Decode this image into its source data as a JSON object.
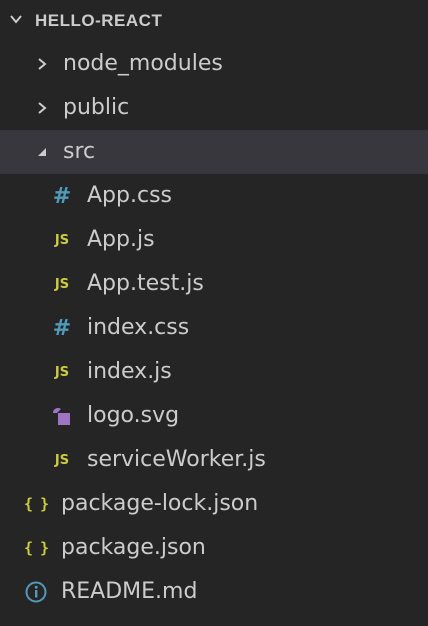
{
  "explorer": {
    "section_title": "HELLO-REACT",
    "items": [
      {
        "label": "node_modules",
        "kind": "folder",
        "state": "collapsed",
        "depth": 1
      },
      {
        "label": "public",
        "kind": "folder",
        "state": "collapsed",
        "depth": 1
      },
      {
        "label": "src",
        "kind": "folder",
        "state": "expanded",
        "depth": 1,
        "selected": true
      },
      {
        "label": "App.css",
        "kind": "css",
        "depth": 2
      },
      {
        "label": "App.js",
        "kind": "js",
        "depth": 2
      },
      {
        "label": "App.test.js",
        "kind": "js",
        "depth": 2
      },
      {
        "label": "index.css",
        "kind": "css",
        "depth": 2
      },
      {
        "label": "index.js",
        "kind": "js",
        "depth": 2
      },
      {
        "label": "logo.svg",
        "kind": "svg",
        "depth": 2
      },
      {
        "label": "serviceWorker.js",
        "kind": "js",
        "depth": 2
      },
      {
        "label": "package-lock.json",
        "kind": "json",
        "depth": 1
      },
      {
        "label": "package.json",
        "kind": "json",
        "depth": 1
      },
      {
        "label": "README.md",
        "kind": "info",
        "depth": 1
      }
    ],
    "icon_glyphs": {
      "js": "JS",
      "css": "#",
      "json": "{ }"
    },
    "colors": {
      "background": "#252526",
      "selected_row": "#37373d",
      "text": "#cccccc",
      "js_icon": "#cbcb41",
      "css_icon": "#519aba",
      "json_icon": "#cbcb41",
      "svg_icon": "#a074c4",
      "info_icon": "#519aba"
    }
  }
}
